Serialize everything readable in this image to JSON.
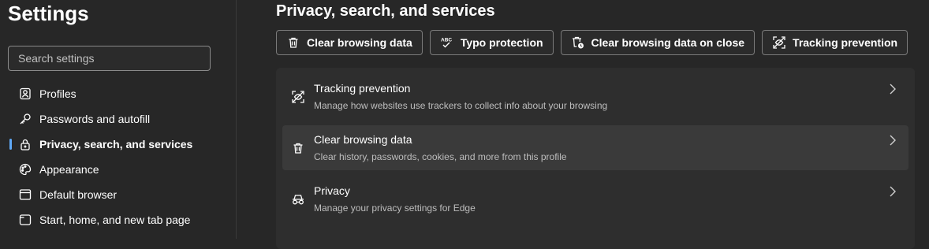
{
  "sidebar": {
    "title": "Settings",
    "search_placeholder": "Search settings",
    "items": [
      {
        "label": "Profiles",
        "icon": "profile-icon"
      },
      {
        "label": "Passwords and autofill",
        "icon": "key-icon"
      },
      {
        "label": "Privacy, search, and services",
        "icon": "lock-icon",
        "active": true
      },
      {
        "label": "Appearance",
        "icon": "palette-icon"
      },
      {
        "label": "Default browser",
        "icon": "browser-icon"
      },
      {
        "label": "Start, home, and new tab page",
        "icon": "home-tab-icon"
      }
    ]
  },
  "main": {
    "title": "Privacy, search, and services",
    "quick_actions": [
      {
        "label": "Clear browsing data",
        "icon": "trash-icon"
      },
      {
        "label": "Typo protection",
        "icon": "abc-check-icon"
      },
      {
        "label": "Clear browsing data on close",
        "icon": "trash-clock-icon"
      },
      {
        "label": "Tracking prevention",
        "icon": "tracking-icon"
      }
    ],
    "rows": [
      {
        "title": "Tracking prevention",
        "subtitle": "Manage how websites use trackers to collect info about your browsing",
        "icon": "tracking-icon"
      },
      {
        "title": "Clear browsing data",
        "subtitle": "Clear history, passwords, cookies, and more from this profile",
        "icon": "trash-icon"
      },
      {
        "title": "Privacy",
        "subtitle": "Manage your privacy settings for Edge",
        "icon": "incognito-icon"
      }
    ]
  },
  "colors": {
    "background": "#272727",
    "card": "#2e2e2e",
    "row_hover": "#3a3a3a",
    "accent": "#5fa8f5",
    "text": "#ffffff",
    "subtext": "#bdbdbd"
  }
}
